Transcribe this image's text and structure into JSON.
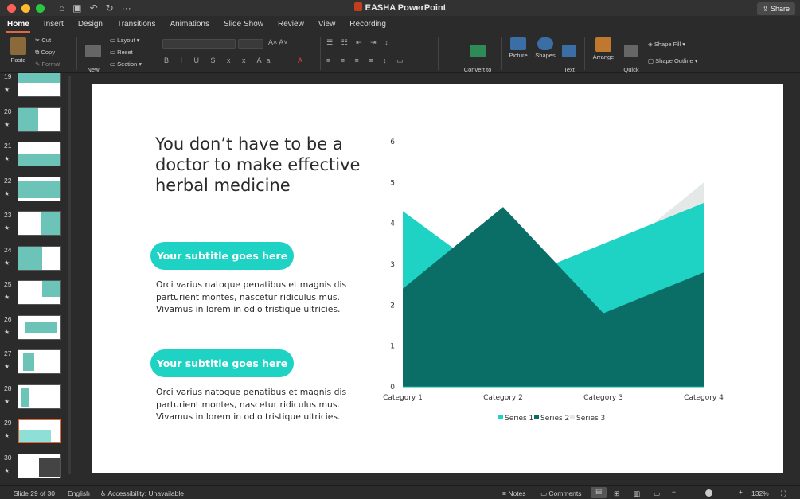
{
  "app": {
    "title": "EASHA PowerPoint"
  },
  "window": {
    "traffic": [
      "#fe5f57",
      "#febc2e",
      "#28c840"
    ]
  },
  "tabs": [
    "Home",
    "Insert",
    "Design",
    "Transitions",
    "Animations",
    "Slide Show",
    "Review",
    "View",
    "Recording"
  ],
  "share_label": "Share",
  "ribbon": {
    "paste": "Paste",
    "cut": "Cut",
    "copy": "Copy",
    "format": "Format",
    "new_slide": "New\nSlide",
    "layout": "Layout",
    "reset": "Reset",
    "section": "Section",
    "convert_smartart": "Convert to\nSmartArt",
    "picture": "Picture",
    "shapes": "Shapes",
    "text_box": "Text\nBox",
    "arrange": "Arrange",
    "quick_styles": "Quick\nStyles",
    "shape_fill": "Shape Fill",
    "shape_outline": "Shape Outline"
  },
  "thumbnails": [
    {
      "num": "19",
      "selected": false
    },
    {
      "num": "20",
      "selected": false
    },
    {
      "num": "21",
      "selected": false
    },
    {
      "num": "22",
      "selected": false
    },
    {
      "num": "23",
      "selected": false
    },
    {
      "num": "24",
      "selected": false
    },
    {
      "num": "25",
      "selected": false
    },
    {
      "num": "26",
      "selected": false
    },
    {
      "num": "27",
      "selected": false
    },
    {
      "num": "28",
      "selected": false
    },
    {
      "num": "29",
      "selected": true
    },
    {
      "num": "30",
      "selected": false
    }
  ],
  "slide": {
    "title": "You don’t have to be a doctor to make effective herbal medicine",
    "subtitle_1": "Your subtitle goes here",
    "body_1": "Orci varius natoque penatibus et magnis dis parturient montes, nascetur ridiculus mus. Vivamus in lorem in odio tristique ultricies.",
    "subtitle_2": "Your subtitle goes here",
    "body_2": "Orci varius natoque penatibus et magnis dis parturient montes, nascetur ridiculus mus. Vivamus in lorem in odio tristique ultricies."
  },
  "chart_data": {
    "type": "area",
    "categories": [
      "Category 1",
      "Category 2",
      "Category 3",
      "Category 4"
    ],
    "series": [
      {
        "name": "Series 1",
        "values": [
          4.3,
          2.5,
          3.5,
          4.5
        ],
        "color": "#1ed3c4"
      },
      {
        "name": "Series 2",
        "values": [
          2.4,
          4.4,
          1.8,
          2.8
        ],
        "color": "#0b6e66"
      },
      {
        "name": "Series 3",
        "values": [
          2,
          2,
          3,
          5
        ],
        "color": "#e4e9e8"
      }
    ],
    "yticks": [
      "0",
      "1",
      "2",
      "3",
      "4",
      "5",
      "6"
    ],
    "ylim": [
      0,
      6
    ],
    "legend": "bottom",
    "grid": false
  },
  "status": {
    "slide_of": "Slide 29 of 30",
    "language": "English",
    "accessibility": "Accessibility: Unavailable",
    "notes": "Notes",
    "comments": "Comments",
    "zoom": "132%"
  }
}
